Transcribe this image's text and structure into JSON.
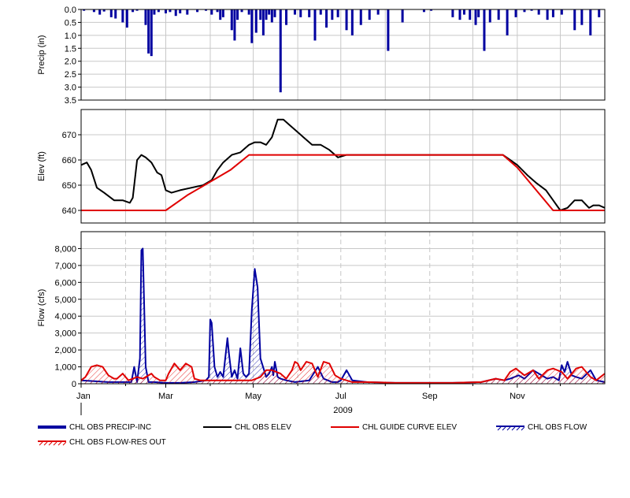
{
  "chart_data": {
    "type": "line",
    "panels": [
      {
        "id": "precip",
        "ylabel": "Precip (in)",
        "ylim": [
          0.0,
          3.5
        ],
        "inverted": true,
        "yticks": [
          "0.0",
          "0.5",
          "1.0",
          "1.5",
          "2.0",
          "2.5",
          "3.0",
          "3.5"
        ],
        "grid": true
      },
      {
        "id": "elev",
        "ylabel": "Elev (ft)",
        "ylim": [
          635,
          680
        ],
        "yticks": [
          "640",
          "650",
          "660",
          "670"
        ],
        "grid": true
      },
      {
        "id": "flow",
        "ylabel": "Flow (cfs)",
        "ylim": [
          0,
          9000
        ],
        "yticks": [
          "0",
          "1,000",
          "2,000",
          "3,000",
          "4,000",
          "5,000",
          "6,000",
          "7,000",
          "8,000"
        ],
        "grid": true
      }
    ],
    "x_axis": {
      "year_label": "2009",
      "tick_labels": [
        "Jan",
        "Mar",
        "May",
        "Jul",
        "Sep",
        "Nov"
      ],
      "tick_days": [
        1,
        60,
        121,
        182,
        244,
        305
      ],
      "minor_month_days": [
        32,
        91,
        152,
        213,
        274,
        335
      ],
      "xlim_days": [
        1,
        366
      ]
    },
    "series": [
      {
        "name": "CHL OBS PRECIP-INC",
        "color": "#0000a0",
        "panel": "precip",
        "style": "bars",
        "x_day": [
          3,
          10,
          14,
          17,
          22,
          25,
          30,
          33,
          37,
          40,
          46,
          48,
          50,
          52,
          55,
          60,
          63,
          67,
          70,
          75,
          82,
          88,
          92,
          96,
          98,
          100,
          106,
          108,
          110,
          113,
          118,
          120,
          123,
          126,
          128,
          130,
          132,
          134,
          136,
          140,
          144,
          150,
          154,
          160,
          164,
          168,
          172,
          176,
          180,
          186,
          190,
          196,
          202,
          208,
          215,
          225,
          240,
          245,
          260,
          265,
          268,
          272,
          276,
          278,
          282,
          286,
          292,
          298,
          304,
          310,
          315,
          320,
          326,
          330,
          336,
          345,
          350,
          356,
          362
        ],
        "values": [
          0.05,
          0.1,
          0.2,
          0.08,
          0.3,
          0.35,
          0.5,
          0.7,
          0.1,
          0.05,
          0.6,
          1.7,
          1.8,
          0.2,
          0.1,
          0.15,
          0.1,
          0.25,
          0.15,
          0.2,
          0.1,
          0.05,
          0.2,
          0.1,
          0.4,
          0.3,
          0.8,
          1.2,
          0.4,
          0.1,
          0.2,
          1.3,
          0.9,
          0.4,
          1.0,
          0.4,
          0.2,
          0.5,
          0.3,
          3.2,
          0.6,
          0.2,
          0.3,
          0.3,
          1.2,
          0.2,
          0.7,
          0.4,
          0.3,
          0.8,
          1.0,
          0.6,
          0.4,
          0.2,
          1.6,
          0.5,
          0.1,
          0.05,
          0.3,
          0.4,
          0.2,
          0.4,
          0.6,
          0.3,
          1.6,
          0.5,
          0.4,
          1.0,
          0.3,
          0.1,
          0.05,
          0.2,
          0.4,
          0.3,
          0.2,
          0.8,
          0.6,
          1.0,
          0.3
        ]
      },
      {
        "name": "CHL OBS ELEV",
        "color": "#000000",
        "panel": "elev",
        "style": "line",
        "x_day": [
          1,
          5,
          8,
          12,
          17,
          24,
          30,
          35,
          37,
          40,
          43,
          46,
          50,
          54,
          57,
          60,
          64,
          70,
          78,
          86,
          92,
          96,
          100,
          106,
          112,
          118,
          122,
          126,
          130,
          134,
          138,
          142,
          146,
          150,
          156,
          162,
          168,
          174,
          180,
          186,
          192,
          200,
          220,
          240,
          260,
          280,
          295,
          300,
          305,
          312,
          318,
          325,
          330,
          335,
          340,
          345,
          350,
          355,
          358,
          362,
          366
        ],
        "values": [
          658,
          659,
          656,
          649,
          647,
          644,
          644,
          643,
          645,
          660,
          662,
          661,
          659,
          655,
          654,
          648,
          647,
          648,
          649,
          650,
          652,
          656,
          659,
          662,
          663,
          666,
          667,
          667,
          666,
          669,
          676,
          676,
          674,
          672,
          669,
          666,
          666,
          664,
          661,
          662,
          662,
          662,
          662,
          662,
          662,
          662,
          662,
          660,
          658,
          654,
          651,
          648,
          644,
          640,
          641,
          644,
          644,
          641,
          642,
          642,
          641
        ]
      },
      {
        "name": "CHL GUIDE CURVE ELEV",
        "color": "#e00000",
        "panel": "elev",
        "style": "line",
        "x_day": [
          1,
          60,
          75,
          90,
          105,
          118,
          182,
          244,
          295,
          305,
          330,
          335,
          366
        ],
        "values": [
          640,
          640,
          646,
          651,
          656,
          662,
          662,
          662,
          662,
          657,
          640,
          640,
          640
        ]
      },
      {
        "name": "CHL OBS FLOW",
        "color": "#0000a0",
        "panel": "flow",
        "style": "line-hatched",
        "x_day": [
          1,
          20,
          36,
          38,
          40,
          42,
          43,
          44,
          46,
          48,
          52,
          60,
          70,
          80,
          88,
          90,
          91,
          92,
          94,
          96,
          98,
          100,
          103,
          104,
          106,
          108,
          110,
          112,
          114,
          116,
          118,
          120,
          122,
          124,
          126,
          130,
          132,
          134,
          135,
          136,
          138,
          140,
          144,
          150,
          160,
          166,
          170,
          176,
          180,
          182,
          186,
          190,
          200,
          220,
          240,
          260,
          280,
          290,
          296,
          300,
          306,
          310,
          316,
          320,
          326,
          330,
          334,
          336,
          338,
          340,
          343,
          346,
          350,
          356,
          360,
          366
        ],
        "values": [
          200,
          100,
          100,
          1000,
          100,
          1500,
          7900,
          8000,
          1000,
          100,
          100,
          50,
          50,
          100,
          200,
          400,
          3800,
          3600,
          1000,
          400,
          700,
          400,
          2700,
          1800,
          400,
          800,
          300,
          2100,
          600,
          400,
          600,
          4400,
          6800,
          5700,
          1500,
          400,
          600,
          1000,
          500,
          1300,
          400,
          300,
          200,
          100,
          200,
          1000,
          300,
          100,
          100,
          200,
          800,
          200,
          100,
          50,
          50,
          50,
          100,
          300,
          200,
          300,
          500,
          300,
          800,
          600,
          300,
          400,
          200,
          1100,
          700,
          1300,
          500,
          400,
          300,
          800,
          200,
          100
        ]
      },
      {
        "name": "CHL OBS FLOW-RES OUT",
        "color": "#e00000",
        "panel": "flow",
        "style": "line-hatched",
        "x_day": [
          1,
          4,
          8,
          12,
          16,
          20,
          24,
          26,
          30,
          34,
          40,
          44,
          50,
          52,
          56,
          60,
          62,
          66,
          70,
          74,
          78,
          80,
          84,
          90,
          100,
          110,
          120,
          126,
          130,
          134,
          140,
          144,
          148,
          150,
          152,
          154,
          158,
          162,
          166,
          170,
          174,
          178,
          182,
          190,
          200,
          220,
          240,
          260,
          280,
          290,
          296,
          300,
          304,
          310,
          316,
          320,
          326,
          330,
          336,
          340,
          346,
          350,
          356,
          360,
          366
        ],
        "values": [
          200,
          400,
          1000,
          1100,
          1000,
          500,
          300,
          300,
          600,
          200,
          400,
          300,
          600,
          400,
          200,
          200,
          600,
          1200,
          800,
          1200,
          1000,
          300,
          200,
          200,
          200,
          200,
          200,
          400,
          800,
          800,
          600,
          300,
          800,
          1300,
          1200,
          800,
          1300,
          1200,
          400,
          1300,
          1200,
          500,
          300,
          100,
          100,
          50,
          50,
          50,
          100,
          300,
          200,
          700,
          900,
          500,
          800,
          300,
          800,
          900,
          700,
          300,
          900,
          1000,
          400,
          200,
          600
        ]
      }
    ],
    "legend": {
      "items": [
        "CHL OBS PRECIP-INC",
        "CHL OBS ELEV",
        "CHL GUIDE CURVE ELEV",
        "CHL OBS FLOW",
        "CHL OBS FLOW-RES OUT"
      ],
      "placement": "bottom"
    }
  }
}
